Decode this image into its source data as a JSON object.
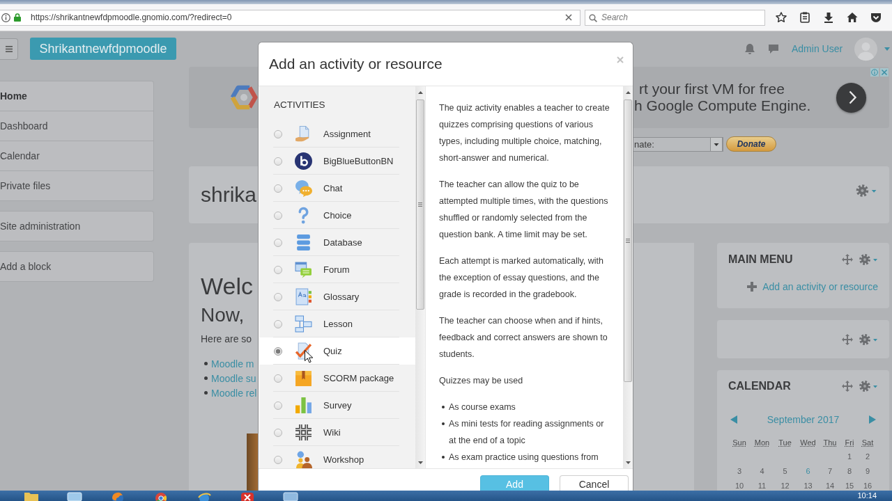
{
  "browser": {
    "url": "https://shrikantnewfdpmoodle.gnomio.com/?redirect=0",
    "search": {
      "placeholder": "Search"
    }
  },
  "navbar": {
    "brand": "Shrikantnewfdpmoodle",
    "user": "Admin User"
  },
  "sidebar": {
    "blocks": [
      {
        "items": [
          {
            "label": "Home",
            "selected": true
          },
          {
            "label": "Dashboard",
            "selected": false
          },
          {
            "label": "Calendar",
            "selected": false
          },
          {
            "label": "Private files",
            "selected": false
          }
        ]
      },
      {
        "items": [
          {
            "label": "Site administration",
            "selected": false
          }
        ]
      },
      {
        "items": [
          {
            "label": "Add a block",
            "selected": false
          }
        ]
      }
    ]
  },
  "ad": {
    "lines": [
      "rt your first VM for free",
      "h Google Compute Engine."
    ]
  },
  "donate": {
    "select_value": "nate:",
    "button": "Donate"
  },
  "course": {
    "title": "shrika",
    "heading": "Welc",
    "subheading": "Now,",
    "intro": "Here are so",
    "links": [
      "Moodle m",
      "Moodle su",
      "Moodle rel"
    ]
  },
  "modal": {
    "title": "Add an activity or resource",
    "section": "ACTIVITIES",
    "activities": [
      {
        "label": "Assignment",
        "kind": "assignment",
        "selected": false
      },
      {
        "label": "BigBlueButtonBN",
        "kind": "bigbluebutton",
        "selected": false
      },
      {
        "label": "Chat",
        "kind": "chat",
        "selected": false
      },
      {
        "label": "Choice",
        "kind": "choice",
        "selected": false
      },
      {
        "label": "Database",
        "kind": "database",
        "selected": false
      },
      {
        "label": "Forum",
        "kind": "forum",
        "selected": false
      },
      {
        "label": "Glossary",
        "kind": "glossary",
        "selected": false
      },
      {
        "label": "Lesson",
        "kind": "lesson",
        "selected": false
      },
      {
        "label": "Quiz",
        "kind": "quiz",
        "selected": true
      },
      {
        "label": "SCORM package",
        "kind": "scorm",
        "selected": false
      },
      {
        "label": "Survey",
        "kind": "survey",
        "selected": false
      },
      {
        "label": "Wiki",
        "kind": "wiki",
        "selected": false
      },
      {
        "label": "Workshop",
        "kind": "workshop",
        "selected": false
      }
    ],
    "description": {
      "paragraphs": [
        "The quiz activity enables a teacher to create quizzes comprising questions of various types, including multiple choice, matching, short-answer and numerical.",
        "The teacher can allow the quiz to be attempted multiple times, with the questions shuffled or randomly selected from the question bank. A time limit may be set.",
        "Each attempt is marked automatically, with the exception of essay questions, and the grade is recorded in the gradebook.",
        "The teacher can choose when and if hints, feedback and correct answers are shown to students.",
        "Quizzes may be used"
      ],
      "bullets": [
        "As course exams",
        "As mini tests for reading assignments or at the end of a topic",
        "As exam practice using questions from"
      ]
    },
    "buttons": [
      {
        "label": "Add",
        "kind": "primary"
      },
      {
        "label": "Cancel",
        "kind": "secondary"
      }
    ]
  },
  "blocks": [
    {
      "kind": "menu",
      "title": "MAIN MENU",
      "link": "Add an activity or resource"
    },
    {
      "kind": "empty"
    },
    {
      "kind": "calendar",
      "title": "CALENDAR",
      "month": "September 2017",
      "weekdays": [
        "Sun",
        "Mon",
        "Tue",
        "Wed",
        "Thu",
        "Fri",
        "Sat"
      ],
      "weeks": [
        [
          {
            "day": "1",
            "today": false
          },
          {
            "day": "2",
            "today": false
          }
        ],
        [
          {
            "day": "3",
            "today": false
          },
          {
            "day": "4",
            "today": false
          },
          {
            "day": "5",
            "today": false
          },
          {
            "day": "6",
            "today": true
          },
          {
            "day": "7",
            "today": false
          },
          {
            "day": "8",
            "today": false
          },
          {
            "day": "9",
            "today": false
          }
        ],
        [
          {
            "day": "10",
            "today": false
          },
          {
            "day": "11",
            "today": false
          },
          {
            "day": "12",
            "today": false
          },
          {
            "day": "13",
            "today": false
          },
          {
            "day": "14",
            "today": false
          },
          {
            "day": "15",
            "today": false
          },
          {
            "day": "16",
            "today": false
          }
        ]
      ]
    }
  ],
  "taskbar": {
    "clock": "10:14"
  }
}
